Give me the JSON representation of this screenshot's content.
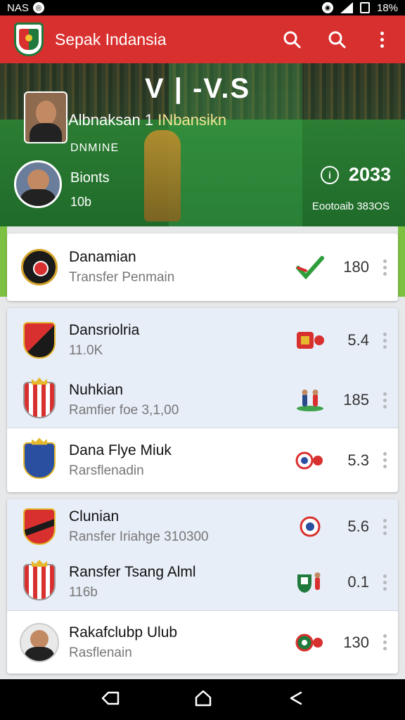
{
  "status_bar": {
    "left_text": "NAS",
    "right_text": "18%"
  },
  "app_bar": {
    "title": "Sepak Indansia",
    "actions": [
      "search-icon",
      "search-icon",
      "more-vert-icon"
    ]
  },
  "hero": {
    "vs_text": "V | -V.S",
    "match_title_a": "Albnaksan",
    "match_title_num": " 1 ",
    "match_title_b": "INbansikn",
    "subtitle": "DNMINE",
    "player_name": "Bionts",
    "player_number": "10b",
    "score": "2033",
    "footer": "Eootoaib 383OS"
  },
  "items": [
    {
      "name": "Danamian",
      "sub": "Transfer Penmain",
      "value": "180",
      "indicator": "check-icon",
      "bg": "white"
    },
    {
      "name": "Dansriolria",
      "sub": "11.0K",
      "value": "5.4",
      "indicator": "crest-icon",
      "bg": "blue"
    },
    {
      "name": "Nuhkian",
      "sub": "Ramfier foe 3,1,00",
      "value": "185",
      "indicator": "players-icon",
      "bg": "blue"
    },
    {
      "name": "Dana Flye Miuk",
      "sub": "Rarsflenadin",
      "value": "5.3",
      "indicator": "badge-icon",
      "bg": "white"
    },
    {
      "name": "Clunian",
      "sub": "Ransfer Iriahge 310300",
      "value": "5.6",
      "indicator": "badge-icon",
      "bg": "blue"
    },
    {
      "name": "Ransfer Tsang Alml",
      "sub": "116b",
      "value": "0.1",
      "indicator": "players-icon",
      "bg": "blue"
    },
    {
      "name": "Rakafclubp Ulub",
      "sub": "Rasflenain",
      "value": "130",
      "indicator": "badge-icon",
      "bg": "white"
    }
  ],
  "colors": {
    "app_bar": "#d8302f",
    "accent": "#7dc142",
    "blue_row": "#e8eef8"
  }
}
